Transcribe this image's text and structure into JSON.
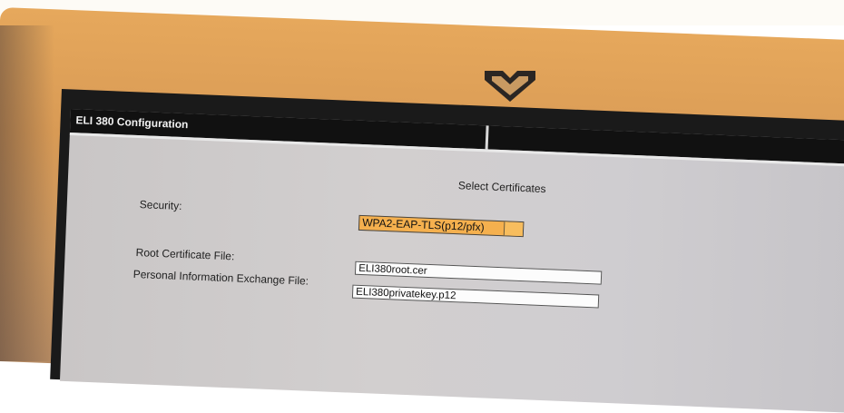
{
  "window": {
    "title": "ELI 380 Configuration"
  },
  "page": {
    "heading": "Select Certificates"
  },
  "form": {
    "security_label": "Security:",
    "security_value": "WPA2-EAP-TLS(p12/pfx)",
    "root_cert_label": "Root Certificate File:",
    "root_cert_value": "ELI380root.cer",
    "pfx_label": "Personal Information Exchange File:",
    "pfx_value": "ELI380privatekey.p12"
  },
  "icons": {
    "brand_logo": "heart-logo-icon"
  },
  "colors": {
    "title_bar": "#111111",
    "window_bg": "#cfcdcd",
    "dropdown_bg": "#f5b04e",
    "bezel": "#d89a55"
  }
}
